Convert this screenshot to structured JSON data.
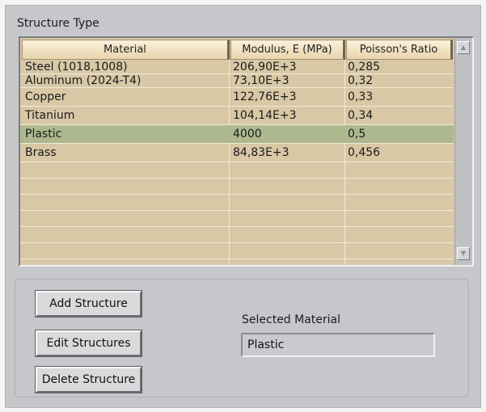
{
  "section_title": "Structure Type",
  "table": {
    "columns": [
      "Material",
      "Modulus, E (MPa)",
      "Poisson's Ratio"
    ],
    "rows": [
      {
        "material": "Steel (1018,1008)",
        "modulus": "206,90E+3",
        "poisson": "0,285"
      },
      {
        "material": "Aluminum (2024-T4)",
        "modulus": "73,10E+3",
        "poisson": "0,32"
      },
      {
        "material": "Copper",
        "modulus": "122,76E+3",
        "poisson": "0,33"
      },
      {
        "material": "Titanium",
        "modulus": "104,14E+3",
        "poisson": "0,34"
      },
      {
        "material": "Plastic",
        "modulus": "4000",
        "poisson": "0,5"
      },
      {
        "material": "Brass",
        "modulus": "84,83E+3",
        "poisson": "0,456"
      }
    ],
    "selected_row": "Plastic",
    "highlight_color": "#aeb88f",
    "row_color": "#d8c8a6"
  },
  "buttons": {
    "add": "Add Structure",
    "edit": "Edit Structures",
    "delete": "Delete Structure"
  },
  "selected_material": {
    "label": "Selected Material",
    "value": "Plastic"
  },
  "icons": {
    "scroll_up": "scroll-up-arrow",
    "scroll_down": "scroll-down-arrow"
  }
}
